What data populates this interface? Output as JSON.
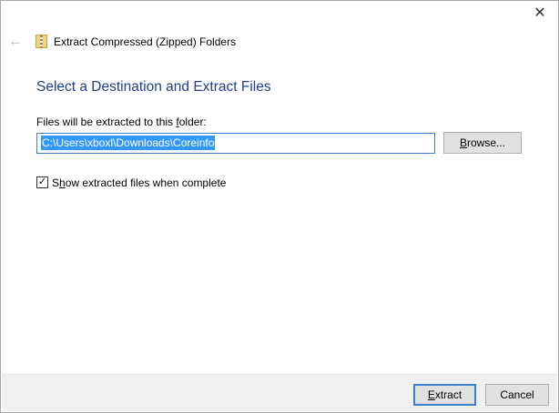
{
  "window": {
    "title": "Extract Compressed (Zipped) Folders",
    "close": "✕",
    "back": "←"
  },
  "heading": "Select a Destination and Extract Files",
  "destination": {
    "label_pre": "Files will be extracted to this ",
    "label_key": "f",
    "label_post": "older:",
    "value": "C:\\Users\\xboxl\\Downloads\\Coreinfo",
    "browse_key": "B",
    "browse_rest": "rowse..."
  },
  "show_files": {
    "checked": true,
    "check_mark": "✓",
    "label_pre": "S",
    "label_key": "h",
    "label_post": "ow extracted files when complete"
  },
  "footer": {
    "extract_key": "E",
    "extract_rest": "xtract",
    "cancel": "Cancel"
  }
}
